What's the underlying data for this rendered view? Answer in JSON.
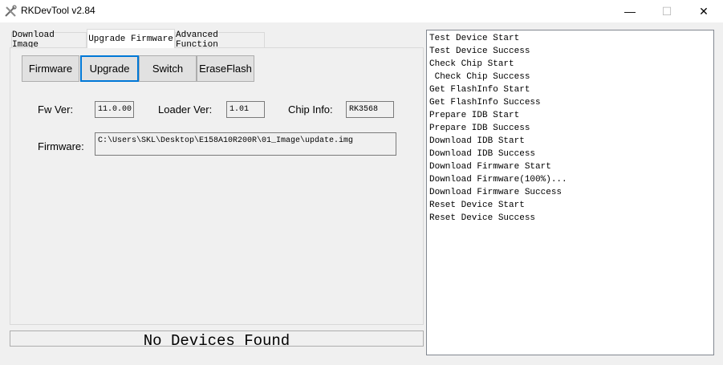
{
  "window": {
    "title": "RKDevTool v2.84",
    "minimize_glyph": "—",
    "maximize_glyph": "☐",
    "close_glyph": "✕"
  },
  "tabs": [
    {
      "label": "Download Image",
      "active": false
    },
    {
      "label": "Upgrade Firmware",
      "active": true
    },
    {
      "label": "Advanced Function",
      "active": false
    }
  ],
  "buttons": {
    "firmware": "Firmware",
    "upgrade": "Upgrade",
    "switch": "Switch",
    "erase_flash": "EraseFlash"
  },
  "fields": {
    "fw_ver_label": "Fw Ver:",
    "fw_ver_value": "11.0.00",
    "loader_ver_label": "Loader Ver:",
    "loader_ver_value": "1.01",
    "chip_info_label": "Chip Info:",
    "chip_info_value": "RK3568",
    "firmware_label": "Firmware:",
    "firmware_path": "C:\\Users\\SKL\\Desktop\\E158A10R200R\\01_Image\\update.img"
  },
  "status": {
    "text": "No Devices Found"
  },
  "log": [
    "Test Device Start",
    "Test Device Success",
    "Check Chip Start",
    " Check Chip Success",
    "Get FlashInfo Start",
    "Get FlashInfo Success",
    "Prepare IDB Start",
    "Prepare IDB Success",
    "Download IDB Start",
    "Download IDB Success",
    "Download Firmware Start",
    "Download Firmware(100%)...",
    "Download Firmware Success",
    "Reset Device Start",
    "Reset Device Success"
  ],
  "colors": {
    "focus_border": "#0078d7",
    "window_bg": "#f0f0f0"
  },
  "icons": {
    "app": "rkdevtool-tools-icon"
  }
}
